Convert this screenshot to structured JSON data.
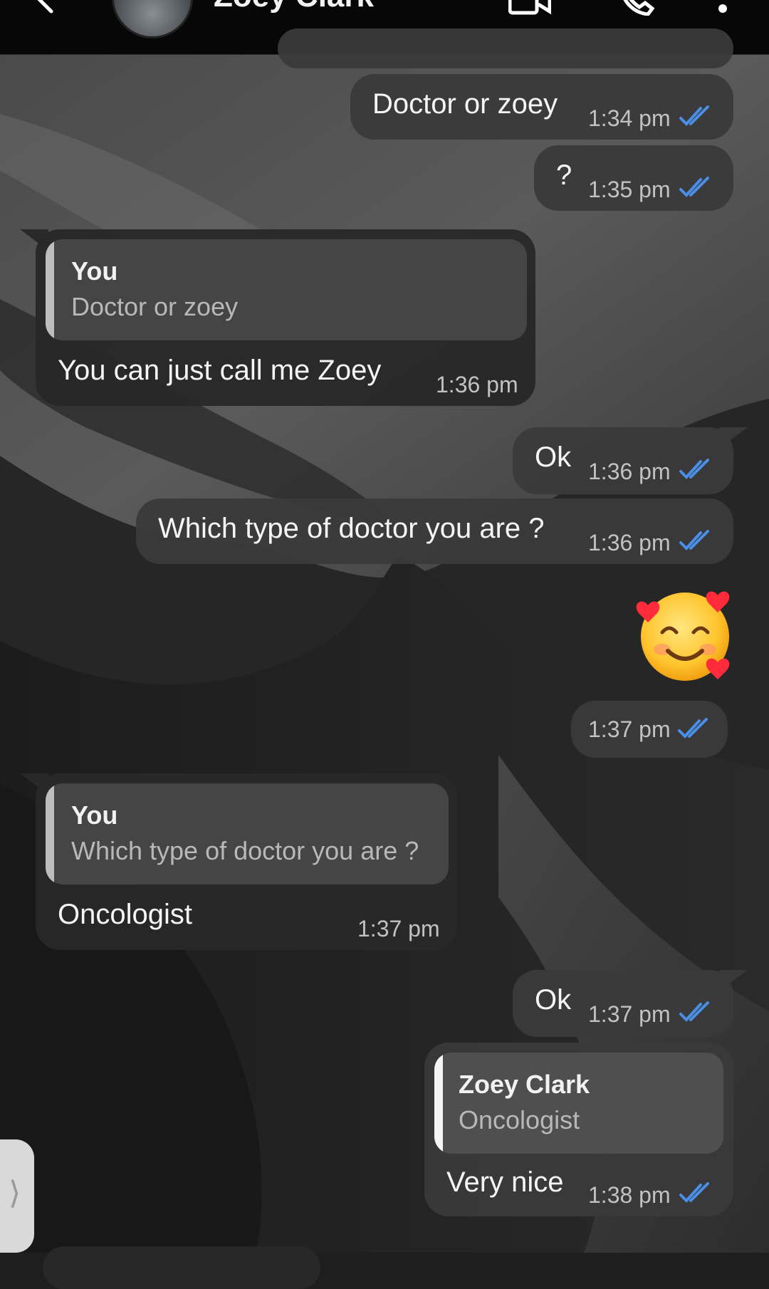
{
  "header": {
    "contact_name": "Zoey Clark"
  },
  "colors": {
    "tick": "#4a8fe7",
    "outgoing": "#3a3a3a",
    "incoming": "#282828"
  },
  "messages": [
    {
      "text": "",
      "time": "1:34 pm",
      "status": "read"
    },
    {
      "text": "Doctor or zoey",
      "time": "1:34 pm",
      "status": "read"
    },
    {
      "text": "?",
      "time": "1:35 pm",
      "status": "read"
    },
    {
      "quote_author": "You",
      "quote_text": "Doctor or zoey",
      "text": "You can just call me Zoey",
      "time": "1:36 pm"
    },
    {
      "text": "Ok",
      "time": "1:36 pm",
      "status": "read"
    },
    {
      "text": "Which type of doctor you are ?",
      "time": "1:36 pm",
      "status": "read"
    },
    {
      "text": "",
      "emoji": "smiling-face-with-hearts",
      "time": "1:37 pm",
      "status": "read"
    },
    {
      "quote_author": "You",
      "quote_text": "Which type of doctor you are ?",
      "text": "Oncologist",
      "time": "1:37 pm"
    },
    {
      "text": "Ok",
      "time": "1:37 pm",
      "status": "read"
    },
    {
      "quote_author": "Zoey Clark",
      "quote_text": "Oncologist",
      "text": "Very nice",
      "time": "1:38 pm",
      "status": "read"
    }
  ],
  "side_handle": {
    "glyph": "⟩"
  }
}
